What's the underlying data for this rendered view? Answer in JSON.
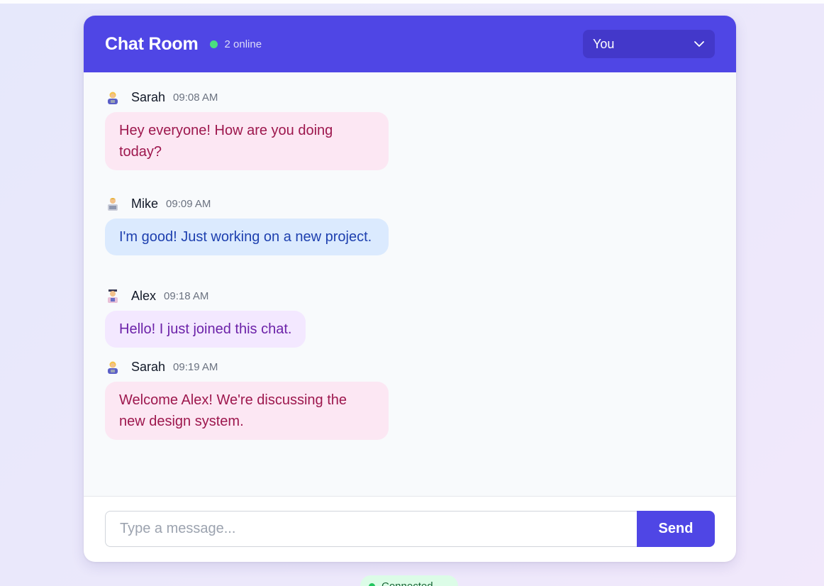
{
  "header": {
    "title": "Chat Room",
    "online_count": "2 online",
    "user_select": {
      "selected": "You",
      "icon": "chevron-down-icon"
    }
  },
  "messages": [
    {
      "sender": "Sarah",
      "time": "09:08 AM",
      "text": "Hey everyone! How are you doing today?",
      "avatar": "woman-technologist-icon",
      "bubble_color": "#fce7f3",
      "text_color": "#9d174d"
    },
    {
      "sender": "Mike",
      "time": "09:09 AM",
      "text": "I'm good! Just working on a new project.",
      "avatar": "man-technologist-icon",
      "bubble_color": "#dbeafe",
      "text_color": "#1e40af"
    },
    {
      "sender": "Alex",
      "time": "09:18 AM",
      "text": "Hello! I just joined this chat.",
      "avatar": "student-icon",
      "bubble_color": "#f3e8ff",
      "text_color": "#6b21a8"
    },
    {
      "sender": "Sarah",
      "time": "09:19 AM",
      "text": "Welcome Alex! We're discussing the new design system.",
      "avatar": "woman-technologist-icon",
      "bubble_color": "#fce7f3",
      "text_color": "#9d174d"
    }
  ],
  "composer": {
    "placeholder": "Type a message...",
    "send_label": "Send"
  },
  "status": {
    "text": "Connected"
  },
  "colors": {
    "accent": "#4f46e5",
    "online": "#4ade80"
  }
}
